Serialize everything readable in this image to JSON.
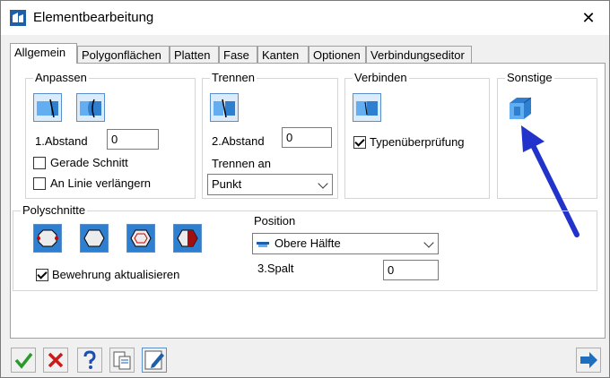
{
  "window": {
    "title": "Elementbearbeitung",
    "close_glyph": "✕"
  },
  "tabs": [
    {
      "label": "Allgemein",
      "active": true
    },
    {
      "label": "Polygonflächen"
    },
    {
      "label": "Platten"
    },
    {
      "label": "Fase"
    },
    {
      "label": "Kanten"
    },
    {
      "label": "Optionen"
    },
    {
      "label": "Verbindungseditor"
    }
  ],
  "anpassen": {
    "title": "Anpassen",
    "abstand_label": "1.Abstand",
    "abstand_value": "0",
    "gerade_schnitt_label": "Gerade Schnitt",
    "gerade_schnitt_checked": false,
    "an_linie_label": "An Linie verlängern",
    "an_linie_checked": false
  },
  "trennen": {
    "title": "Trennen",
    "abstand_label": "2.Abstand",
    "abstand_value": "0",
    "trennen_an_label": "Trennen an",
    "trennen_an_value": "Punkt"
  },
  "verbinden": {
    "title": "Verbinden",
    "typ_label": "Typenüberprüfung",
    "typ_checked": true
  },
  "sonstige": {
    "title": "Sonstige"
  },
  "polyschnitte": {
    "title": "Polyschnitte",
    "bewehrung_label": "Bewehrung aktualisieren",
    "bewehrung_checked": true,
    "position_label": "Position",
    "position_value": "Obere Hälfte",
    "spalt_label": "3.Spalt",
    "spalt_value": "0"
  },
  "colors": {
    "accent": "#1e5fa8",
    "arrow": "#2233cc",
    "icon_bg": "#dcebfa"
  }
}
